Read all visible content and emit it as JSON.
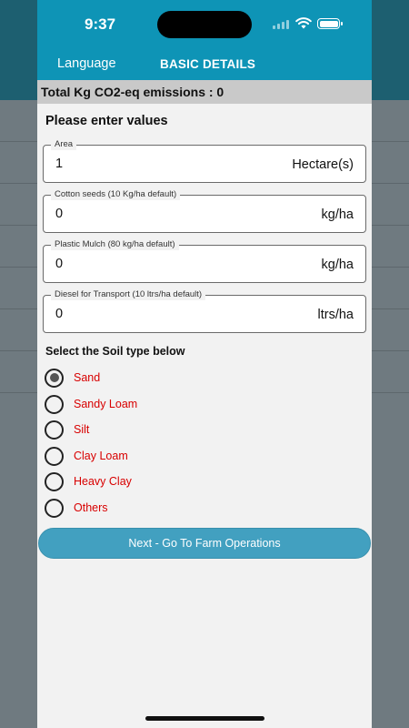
{
  "status": {
    "time": "9:37"
  },
  "tabs": {
    "language": "Language",
    "basic": "BASIC DETAILS"
  },
  "total": "Total Kg CO2-eq emissions : 0",
  "prompt": "Please enter values",
  "fields": [
    {
      "legend": "Area",
      "value": "1",
      "unit": "Hectare(s)"
    },
    {
      "legend": "Cotton seeds (10 Kg/ha default)",
      "value": "0",
      "unit": "kg/ha"
    },
    {
      "legend": "Plastic Mulch (80 kg/ha default)",
      "value": "0",
      "unit": "kg/ha"
    },
    {
      "legend": "Diesel for Transport (10 ltrs/ha default)",
      "value": "0",
      "unit": "ltrs/ha"
    }
  ],
  "soil": {
    "heading": "Select the Soil type below",
    "selected": "Sand",
    "options": [
      "Sand",
      "Sandy Loam",
      "Silt",
      "Clay Loam",
      "Heavy Clay",
      "Others"
    ]
  },
  "next_button": "Next - Go To Farm Operations",
  "colors": {
    "header": "#0e94b6",
    "button": "#42a0c0",
    "soil_label": "#d80000",
    "total_bar": "#c9c9c9"
  }
}
